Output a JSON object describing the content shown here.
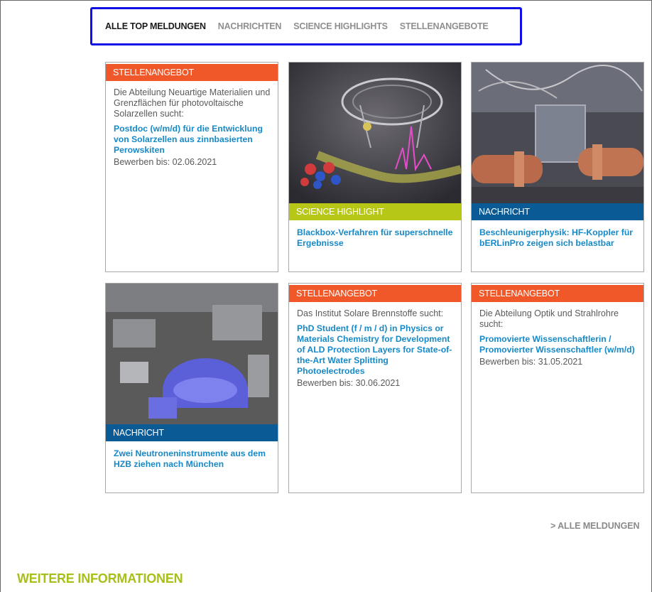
{
  "colors": {
    "stellenangebot": "#f0582a",
    "science_highlight": "#b6c717",
    "nachricht": "#0a5a96",
    "link": "#1689c8",
    "tab_border": "#1010e6",
    "section_title": "#a9bf17"
  },
  "tabs": [
    {
      "label": "ALLE TOP MELDUNGEN",
      "active": true
    },
    {
      "label": "NACHRICHTEN",
      "active": false
    },
    {
      "label": "SCIENCE HIGHLIGHTS",
      "active": false
    },
    {
      "label": "STELLENANGEBOTE",
      "active": false
    }
  ],
  "cards": [
    {
      "type": "STELLENANGEBOT",
      "intro": "Die Abteilung Neuartige Materialien und Grenzflächen für photovoltaische Solarzellen sucht:",
      "title": "Postdoc (w/m/d) für die Entwicklung von Solarzellen aus zinnbasierten Perowskiten",
      "deadline": "Bewerben bis: 02.06.2021"
    },
    {
      "type": "SCIENCE HIGHLIGHT",
      "image": "x-ray-spectroscopy-illustration",
      "title": "Blackbox-Verfahren für superschnelle Ergebnisse"
    },
    {
      "type": "NACHRICHT",
      "image": "accelerator-couplers-photo",
      "title": "Beschleunigerphysik: HF-Koppler für bERLinPro zeigen sich belastbar"
    },
    {
      "type": "NACHRICHT",
      "image": "neutron-hall-photo",
      "title": "Zwei Neutroneninstrumente aus dem HZB ziehen nach München"
    },
    {
      "type": "STELLENANGEBOT",
      "intro": "Das Institut Solare Brennstoffe sucht:",
      "title": "PhD Student (f / m / d) in Physics or Materials Chemistry for Development of ALD Protection Layers for State-of-the-Art Water Splitting Photoelectrodes",
      "deadline": "Bewerben bis: 30.06.2021"
    },
    {
      "type": "STELLENANGEBOT",
      "intro": "Die Abteilung Optik und Strahlrohre sucht:",
      "title": "Promovierte Wissenschaftlerin / Promovierter Wissenschaftler (w/m/d)",
      "deadline": "Bewerben bis: 31.05.2021"
    }
  ],
  "all_news_link": "> ALLE MELDUNGEN",
  "section_title": "WEITERE INFORMATIONEN"
}
